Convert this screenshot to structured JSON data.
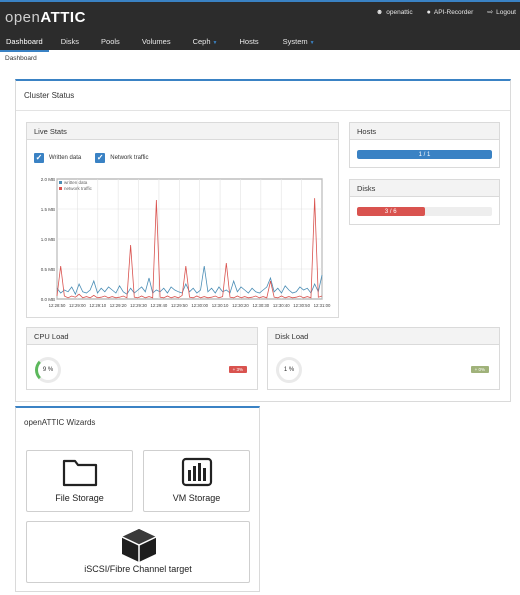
{
  "header": {
    "logo_prefix": "open",
    "logo_brand": "ATTIC",
    "user_label": "openattic",
    "recorder_label": "API-Recorder",
    "logout_label": "Logout"
  },
  "nav": {
    "items": [
      {
        "label": "Dashboard"
      },
      {
        "label": "Disks"
      },
      {
        "label": "Pools"
      },
      {
        "label": "Volumes"
      },
      {
        "label": "Ceph"
      },
      {
        "label": "Hosts"
      },
      {
        "label": "System"
      }
    ]
  },
  "breadcrumb": "Dashboard",
  "cluster_status": {
    "title": "Cluster Status",
    "live_stats": {
      "title": "Live Stats",
      "written_data_label": "Written data",
      "network_traffic_label": "Network traffic"
    },
    "hosts": {
      "title": "Hosts",
      "value_text": "1 / 1",
      "fraction": 1.0
    },
    "disks": {
      "title": "Disks",
      "value_text": "3 / 6",
      "fraction": 0.5
    },
    "cpu_load": {
      "title": "CPU Load",
      "value_text": "9 %",
      "tag": "+ 3%"
    },
    "disk_load": {
      "title": "Disk Load",
      "value_text": "1 %",
      "tag": "+ 0%"
    }
  },
  "wizards": {
    "title": "openATTIC Wizards",
    "items": [
      {
        "label": "File Storage",
        "icon": "folder-icon"
      },
      {
        "label": "VM Storage",
        "icon": "bar-chart-icon"
      },
      {
        "label": "iSCSI/Fibre Channel target",
        "icon": "cube-icon"
      }
    ]
  },
  "colors": {
    "accent": "#3a82c4",
    "written": "#4a8db5",
    "network": "#d9534f",
    "disk_bar": "#d9534f",
    "cpu_tag": "#d9534f",
    "disk_tag": "#a0b27a"
  },
  "chart_data": {
    "type": "line",
    "x_ticks": [
      "12:28:50",
      "12:29:00",
      "12:29:10",
      "12:29:20",
      "12:29:30",
      "12:29:40",
      "12:29:50",
      "12:30:00",
      "12:30:10",
      "12:30:20",
      "12:30:30",
      "12:30:40",
      "12:30:50",
      "12:31:00"
    ],
    "y_ticks": [
      "0.0 MB",
      "0.5 MB",
      "1.0 MB",
      "1.5 MB",
      "2.0 MB"
    ],
    "ylim": [
      0,
      2.0
    ],
    "grid": true,
    "legend_position": "top-left",
    "series": [
      {
        "name": "written data",
        "color": "#4a8db5",
        "values": [
          0.18,
          0.1,
          0.15,
          0.12,
          0.2,
          0.08,
          0.25,
          0.12,
          0.1,
          0.15,
          0.3,
          0.1,
          0.18,
          0.12,
          0.2,
          0.15,
          0.1,
          0.22,
          0.12,
          0.08,
          0.18,
          0.1,
          0.15,
          0.2,
          0.12,
          0.35,
          0.1,
          0.15,
          0.12,
          0.18,
          0.1,
          0.2,
          0.15,
          0.12,
          0.1,
          0.25,
          0.12,
          0.18,
          0.1,
          0.15,
          0.55,
          0.12,
          0.18,
          0.1,
          0.2,
          0.12,
          0.15,
          0.1,
          0.3,
          0.12,
          0.2,
          0.15,
          0.1,
          0.18,
          0.12,
          0.1,
          0.15,
          0.2,
          0.35,
          0.12,
          0.18,
          0.1,
          0.22,
          0.15,
          0.1,
          0.12,
          0.2,
          0.15,
          0.18,
          0.1,
          0.25,
          0.12,
          0.4
        ]
      },
      {
        "name": "network traffic",
        "color": "#d9534f",
        "values": [
          0.05,
          0.55,
          0.05,
          0.02,
          0.05,
          0.03,
          0.08,
          0.02,
          0.04,
          0.02,
          0.06,
          0.02,
          0.03,
          0.05,
          0.02,
          0.04,
          0.02,
          0.03,
          0.05,
          0.02,
          0.9,
          0.03,
          0.02,
          0.05,
          0.02,
          0.04,
          0.02,
          1.65,
          0.03,
          0.02,
          0.05,
          0.02,
          0.04,
          0.02,
          0.06,
          0.55,
          0.03,
          0.02,
          0.05,
          0.02,
          0.04,
          0.02,
          0.03,
          0.05,
          0.02,
          0.04,
          0.6,
          0.03,
          0.02,
          0.05,
          0.02,
          0.04,
          0.02,
          0.03,
          0.05,
          0.02,
          0.04,
          0.02,
          0.3,
          0.03,
          0.02,
          0.05,
          0.02,
          0.04,
          0.02,
          0.03,
          0.05,
          0.02,
          0.04,
          0.02,
          1.68,
          0.03,
          0.05
        ]
      }
    ]
  }
}
